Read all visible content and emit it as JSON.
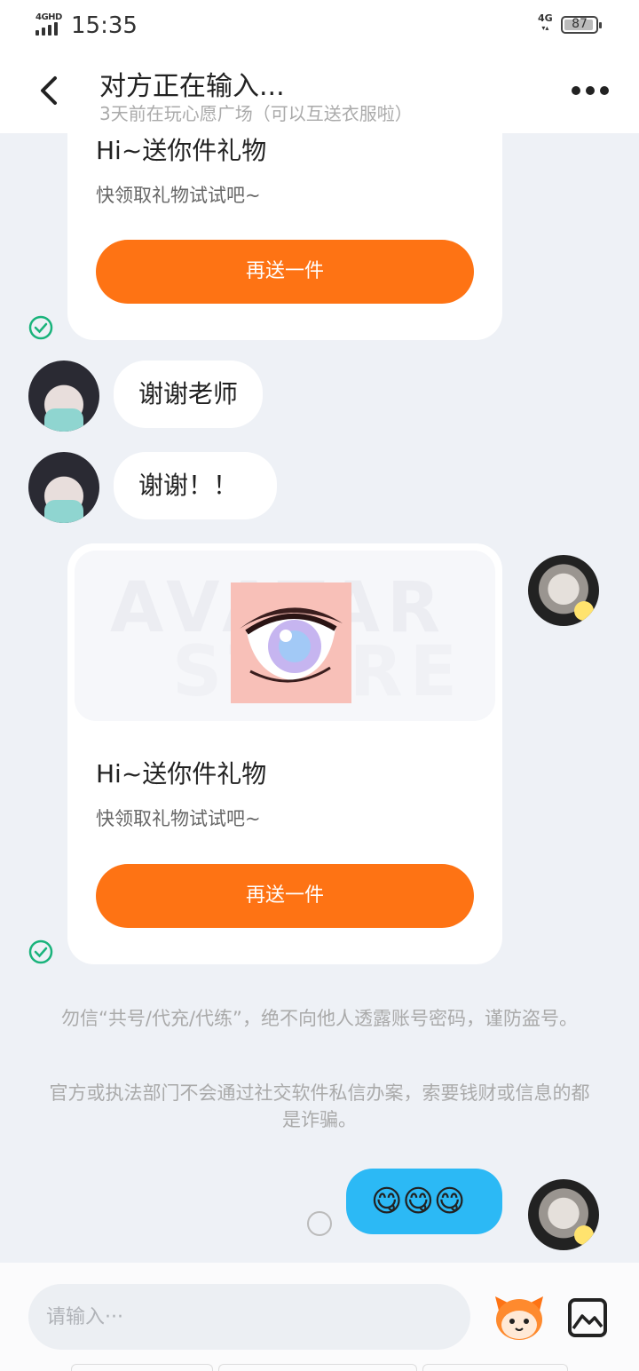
{
  "status_bar": {
    "network": "4GHD",
    "time": "15:35",
    "network_right": "4G",
    "battery": "87"
  },
  "header": {
    "title": "对方正在输入...",
    "subtitle": "3天前在玩心愿广场（可以互送衣服啦）"
  },
  "messages": {
    "gift_card_1": {
      "title": "Hi~送你件礼物",
      "subtitle": "快领取礼物试试吧~",
      "button": "再送一件"
    },
    "reply_1": "谢谢老师",
    "reply_2": "谢谢！！",
    "gift_card_2": {
      "watermark_top": "AVATAR",
      "watermark_bottom": "STORE",
      "title": "Hi~送你件礼物",
      "subtitle": "快领取礼物试试吧~",
      "button": "再送一件"
    },
    "outgoing_emoji": "😋😋😋"
  },
  "notices": {
    "line_1": "勿信“共号/代充/代练”，绝不向他人透露账号密码，谨防盗号。",
    "line_2": "官方或执法部门不会通过社交软件私信办案，索要钱财或信息的都是诈骗。"
  },
  "input": {
    "placeholder": "请输入···"
  },
  "colors": {
    "accent_orange": "#fe7314",
    "bubble_blue": "#2cb9f5",
    "check_green": "#19b37b"
  }
}
